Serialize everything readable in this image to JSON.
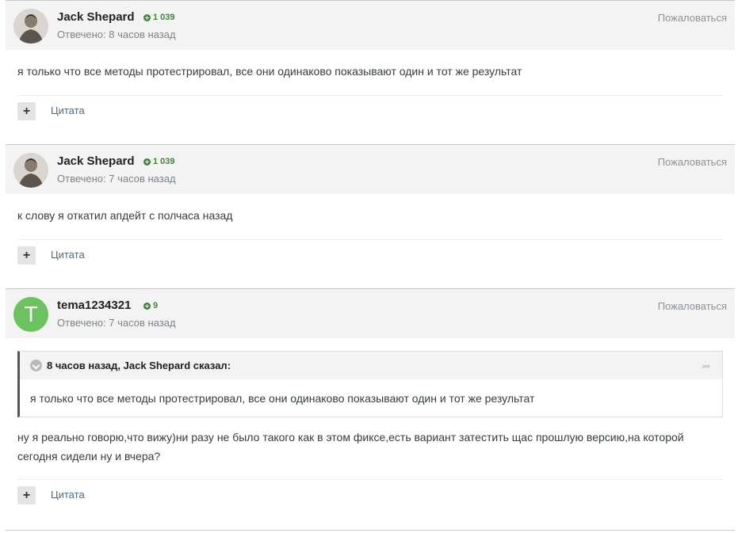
{
  "posts": [
    {
      "author": "Jack Shepard",
      "reputation": "1 039",
      "answered": "Отвечено: 8 часов назад",
      "report": "Пожаловаться",
      "text": "я только что все методы протестрировал, все они одинаково показывают один и тот же результат",
      "plus": "+",
      "quote_label": "Цитата"
    },
    {
      "author": "Jack Shepard",
      "reputation": "1 039",
      "answered": "Отвечено: 7 часов назад",
      "report": "Пожаловаться",
      "text": "к слову я  откатил апдейт с полчаса назад",
      "plus": "+",
      "quote_label": "Цитата"
    },
    {
      "author": "tema1234321",
      "avatar_letter": "T",
      "reputation": "9",
      "answered": "Отвечено: 7 часов назад",
      "report": "Пожаловаться",
      "quote": {
        "citation": "8 часов назад, Jack Shepard сказал:",
        "text": "я только что все методы протестрировал, все они одинаково показывают один и тот же результат"
      },
      "text_line1": "ну я реально говорю,что вижу)ни разу не было такого как в этом фиксе,есть вариант затестить щас прошлую версию,на которой",
      "text_line2": "сегодня сидели ну и вчера?",
      "plus": "+",
      "quote_label": "Цитата"
    }
  ],
  "colors": {
    "avatar_letter_bg": "#6bc25f",
    "reputation": "#41833a",
    "link": "#4e6a86"
  }
}
